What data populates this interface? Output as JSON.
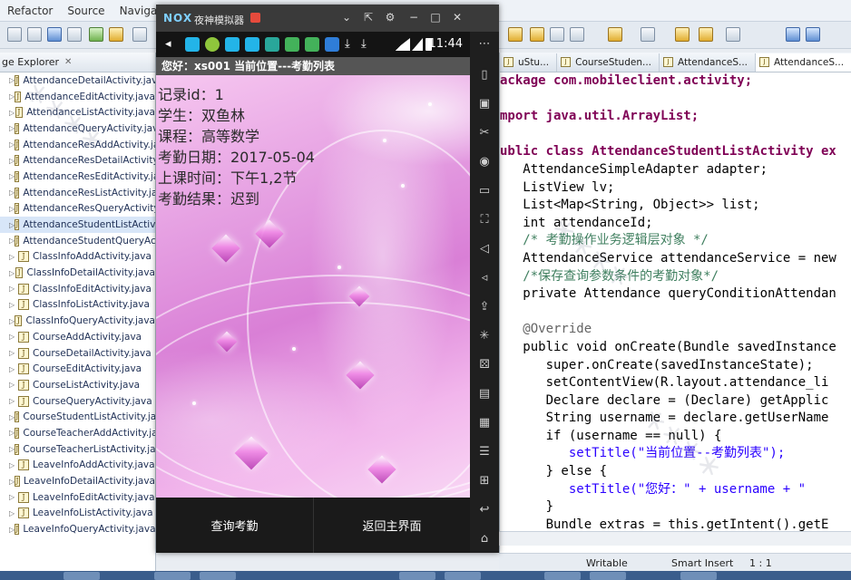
{
  "eclipse": {
    "menu": [
      "Refactor",
      "Source",
      "Navigate"
    ],
    "package_explorer": {
      "title": "ge Explorer",
      "files": [
        "AttendanceDetailActivity.java",
        "AttendanceEditActivity.java",
        "AttendanceListActivity.java",
        "AttendanceQueryActivity.java",
        "AttendanceResAddActivity.java",
        "AttendanceResDetailActivity.java",
        "AttendanceResEditActivity.java",
        "AttendanceResListActivity.java",
        "AttendanceResQueryActivity.java",
        "AttendanceStudentListActivity.java",
        "AttendanceStudentQueryActivity.java",
        "ClassInfoAddActivity.java",
        "ClassInfoDetailActivity.java",
        "ClassInfoEditActivity.java",
        "ClassInfoListActivity.java",
        "ClassInfoQueryActivity.java",
        "CourseAddActivity.java",
        "CourseDetailActivity.java",
        "CourseEditActivity.java",
        "CourseListActivity.java",
        "CourseQueryActivity.java",
        "CourseStudentListActivity.java",
        "CourseTeacherAddActivity.java",
        "CourseTeacherListActivity.java",
        "LeaveInfoAddActivity.java",
        "LeaveInfoDetailActivity.java",
        "LeaveInfoEditActivity.java",
        "LeaveInfoListActivity.java",
        "LeaveInfoQueryActivity.java"
      ],
      "selected_index": 9
    },
    "editor_tabs": [
      "uStu...",
      "CourseStuden...",
      "AttendanceS...",
      "AttendanceS..."
    ],
    "code_lines": [
      "ackage com.mobileclient.activity;",
      "",
      "mport java.util.ArrayList;",
      "",
      "ublic class AttendanceStudentListActivity ex",
      "   AttendanceSimpleAdapter adapter;",
      "   ListView lv;",
      "   List<Map<String, Object>> list;",
      "   int attendanceId;",
      "   /* 考勤操作业务逻辑层对象 */",
      "   AttendanceService attendanceService = new",
      "   /*保存查询参数条件的考勤对象*/",
      "   private Attendance queryConditionAttendan",
      "",
      "   @Override",
      "   public void onCreate(Bundle savedInstance",
      "      super.onCreate(savedInstanceState);",
      "      setContentView(R.layout.attendance_li",
      "      Declare declare = (Declare) getApplic",
      "      String username = declare.getUserName",
      "      if (username == null) {",
      "         setTitle(\"当前位置--考勤列表\");",
      "      } else {",
      "         setTitle(\"您好：\" + username + \"",
      "      }",
      "      Bundle extras = this.getIntent().getE"
    ],
    "status": {
      "writable": "Writable",
      "insert_mode": "Smart Insert",
      "position": "1 : 1"
    }
  },
  "emulator": {
    "brand": "NOX",
    "name": "夜神模拟器",
    "clock": "11:44",
    "app_title": "您好：xs001   当前位置---考勤列表",
    "record": {
      "id_line": "记录id：1",
      "student_line": "学生：双鱼林",
      "course_line": "课程：高等数学",
      "date_line": "考勤日期：2017-05-04",
      "time_line": "上课时间：下午1,2节",
      "result_line": "考勤结果：迟到"
    },
    "buttons": {
      "query": "查询考勤",
      "home": "返回主界面"
    }
  }
}
